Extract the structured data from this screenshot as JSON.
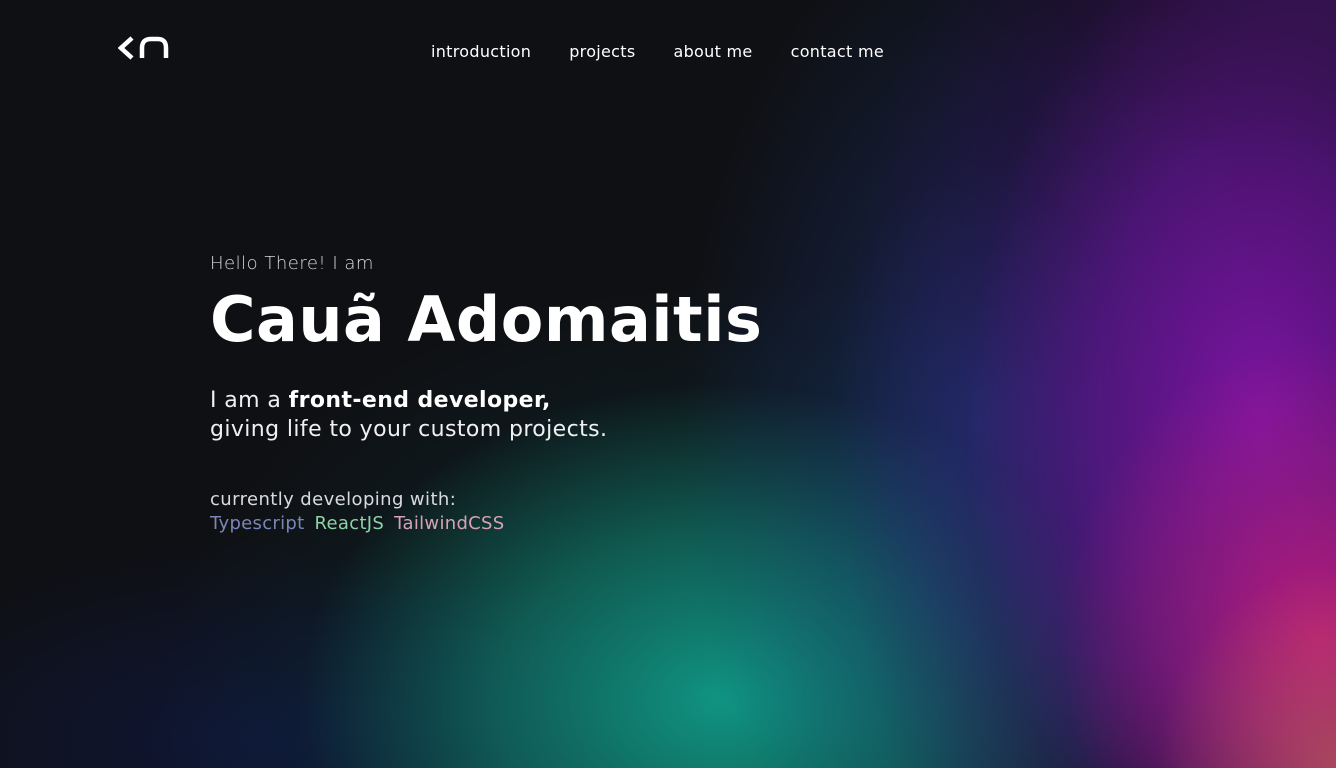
{
  "header": {
    "logo_icon": "ca-monogram-logo",
    "nav": [
      {
        "label": "introduction"
      },
      {
        "label": "projects"
      },
      {
        "label": "about me"
      },
      {
        "label": "contact me"
      }
    ]
  },
  "hero": {
    "greeting": "Hello There! I am",
    "name": "Cauã Adomaitis",
    "tagline_prefix": "I am a ",
    "tagline_strong": "front-end developer,",
    "tagline_line2": "giving life to your custom projects.",
    "stack_label": "currently developing with:",
    "stack": [
      {
        "name": "Typescript",
        "color": "#7b86b8"
      },
      {
        "name": "ReactJS",
        "color": "#8fd1a8"
      },
      {
        "name": "TailwindCSS",
        "color": "#d7a3b4"
      }
    ]
  },
  "colors": {
    "background": "#0f1013",
    "teal": "#10aa96",
    "purple": "#8214aa",
    "magenta": "#c81e78"
  }
}
